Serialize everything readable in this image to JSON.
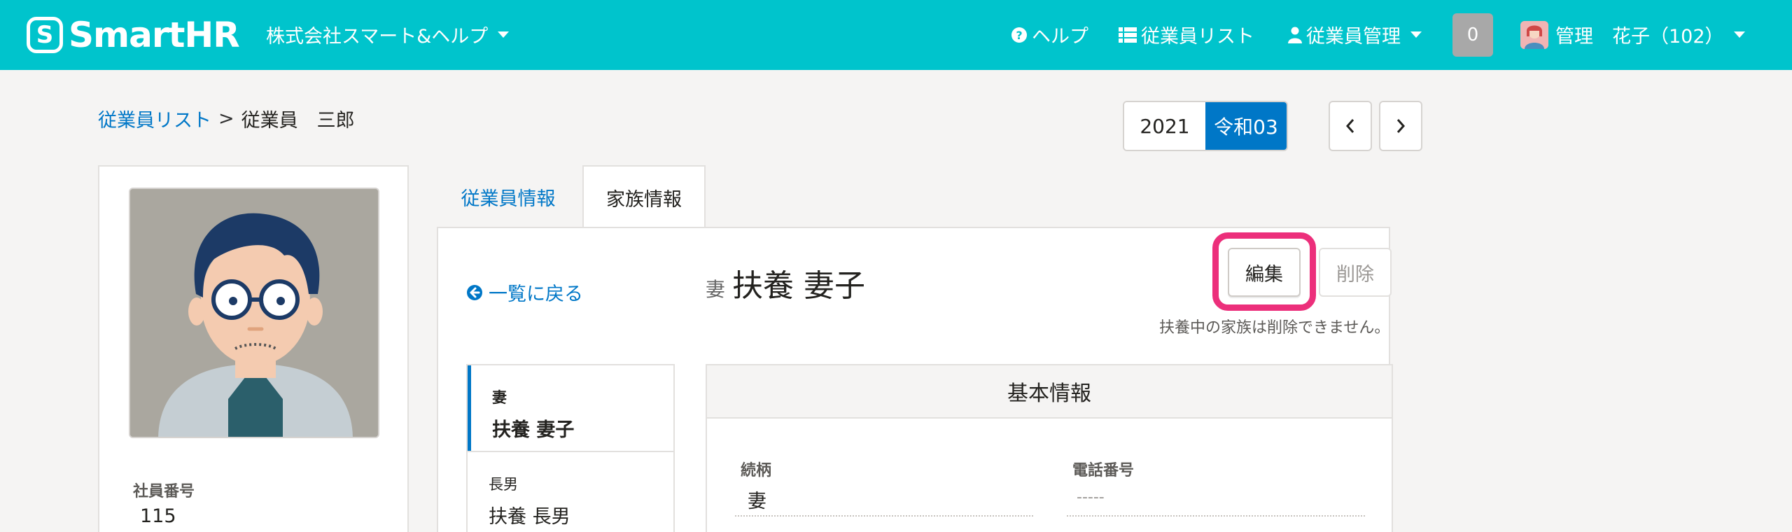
{
  "header": {
    "logo_text": "SmartHR",
    "company": "株式会社スマート&ヘルプ",
    "nav": {
      "help": "ヘルプ",
      "employee_list": "従業員リスト",
      "employee_manage": "従業員管理"
    },
    "notification_count": "0",
    "user_name": "管理　花子（102）"
  },
  "breadcrumb": {
    "parent": "従業員リスト",
    "separator": ">",
    "current": "従業員　三郎"
  },
  "year": {
    "western": "2021",
    "japanese": "令和03"
  },
  "profile": {
    "emp_number_label": "社員番号",
    "emp_number_value": "115"
  },
  "tabs": [
    {
      "label": "従業員情報"
    },
    {
      "label": "家族情報"
    }
  ],
  "family": {
    "back_link": "一覧に戻る",
    "title_relation": "妻",
    "title_name": "扶養 妻子",
    "edit_label": "編集",
    "delete_label": "削除",
    "delete_note": "扶養中の家族は削除できません。",
    "members": [
      {
        "relation": "妻",
        "name": "扶養 妻子"
      },
      {
        "relation": "長男",
        "name": "扶養 長男"
      }
    ]
  },
  "basic_info": {
    "title": "基本情報",
    "fields": [
      {
        "label": "続柄",
        "value": "妻"
      },
      {
        "label": "電話番号",
        "value": "-----"
      }
    ]
  },
  "colors": {
    "header_bg": "#00c4cc",
    "link": "#0077c7",
    "highlight": "#ec2f7b",
    "badge_bg": "#a8a8a8"
  }
}
